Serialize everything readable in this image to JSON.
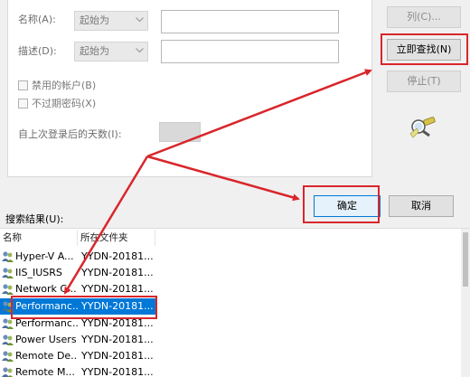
{
  "query": {
    "name_label": "名称(A):",
    "name_mode": "起始为",
    "name_value": "",
    "desc_label": "描述(D):",
    "desc_mode": "起始为",
    "desc_value": "",
    "disabled_accounts_label": "禁用的帐户(B)",
    "no_expire_label": "不过期密码(X)",
    "days_label": "自上次登录后的天数(I):"
  },
  "buttons": {
    "columns": "列(C)...",
    "find_now": "立即查找(N)",
    "stop": "停止(T)",
    "ok": "确定",
    "cancel": "取消"
  },
  "results": {
    "label": "搜索结果(U):",
    "columns": [
      "名称",
      "所在文件夹"
    ],
    "rows": [
      {
        "name": "Hyper-V A...",
        "folder": "YYDN-20181..."
      },
      {
        "name": "IIS_IUSRS",
        "folder": "YYDN-20181..."
      },
      {
        "name": "Network C...",
        "folder": "YYDN-20181..."
      },
      {
        "name": "Performanc...",
        "folder": "YYDN-20181...",
        "selected": true
      },
      {
        "name": "Performanc...",
        "folder": "YYDN-20181..."
      },
      {
        "name": "Power Users",
        "folder": "YYDN-20181..."
      },
      {
        "name": "Remote De...",
        "folder": "YYDN-20181..."
      },
      {
        "name": "Remote M...",
        "folder": "YYDN-20181..."
      }
    ]
  },
  "colors": {
    "annotation_red": "#d9262b",
    "selection_blue": "#0078d7"
  }
}
